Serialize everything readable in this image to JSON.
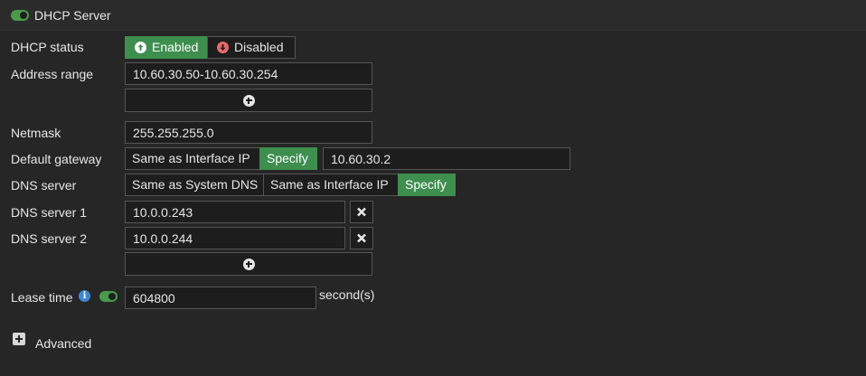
{
  "header": {
    "title": "DHCP Server",
    "enabled": true
  },
  "dhcp_status": {
    "label": "DHCP status",
    "options": [
      {
        "label": "Enabled",
        "icon": "arrow-up-circle-icon",
        "active": true
      },
      {
        "label": "Disabled",
        "icon": "arrow-down-circle-icon",
        "active": false
      }
    ]
  },
  "address_range": {
    "label": "Address range",
    "value": "10.60.30.50-10.60.30.254"
  },
  "netmask": {
    "label": "Netmask",
    "value": "255.255.255.0"
  },
  "default_gateway": {
    "label": "Default gateway",
    "options": [
      "Same as Interface IP",
      "Specify"
    ],
    "selected": "Specify",
    "value": "10.60.30.2"
  },
  "dns_server": {
    "label": "DNS server",
    "options": [
      "Same as System DNS",
      "Same as Interface IP",
      "Specify"
    ],
    "selected": "Specify"
  },
  "dns_server_1": {
    "label": "DNS server 1",
    "value": "10.0.0.243"
  },
  "dns_server_2": {
    "label": "DNS server 2",
    "value": "10.0.0.244"
  },
  "lease_time": {
    "label": "Lease time",
    "value": "604800",
    "unit": "second(s)",
    "enabled": true
  },
  "advanced": {
    "label": "Advanced"
  },
  "colors": {
    "accent": "#3e8e4e",
    "toggle": "#4a9a4a",
    "disabled_icon": "#e36a6a",
    "info": "#3d86d1"
  }
}
